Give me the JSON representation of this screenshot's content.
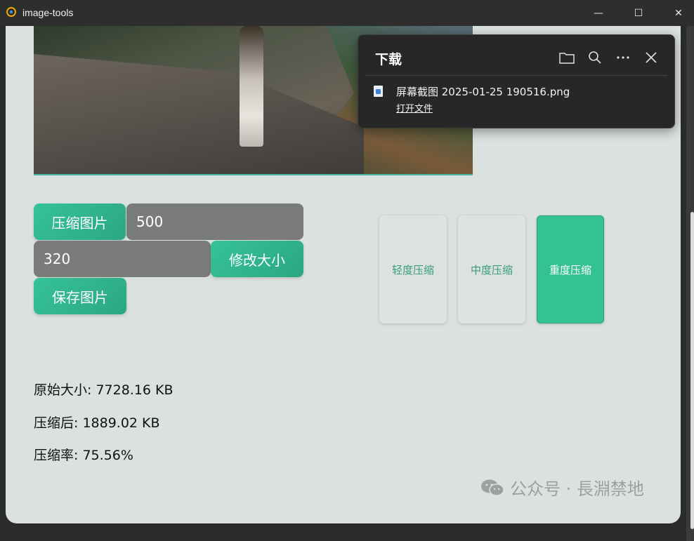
{
  "window": {
    "title": "image-tools",
    "minimize_label": "—",
    "maximize_label": "☐",
    "close_label": "✕"
  },
  "toolbar": {
    "compress_label": "压缩图片",
    "quality_value": "500",
    "height_value": "320",
    "resize_label": "修改大小",
    "save_label": "保存图片"
  },
  "levels": [
    {
      "label": "轻度压缩",
      "active": false
    },
    {
      "label": "中度压缩",
      "active": false
    },
    {
      "label": "重度压缩",
      "active": true
    }
  ],
  "stats": {
    "original": "原始大小: 7728.16 KB",
    "compressed": "压缩后: 1889.02 KB",
    "ratio": "压缩率: 75.56%"
  },
  "watermark": "公众号 · 長淵禁地",
  "downloads": {
    "title": "下载",
    "file_name": "屏幕截图 2025-01-25 190516.png",
    "open_label": "打开文件"
  },
  "colors": {
    "accent": "#34c193",
    "background": "#dbe1de"
  }
}
